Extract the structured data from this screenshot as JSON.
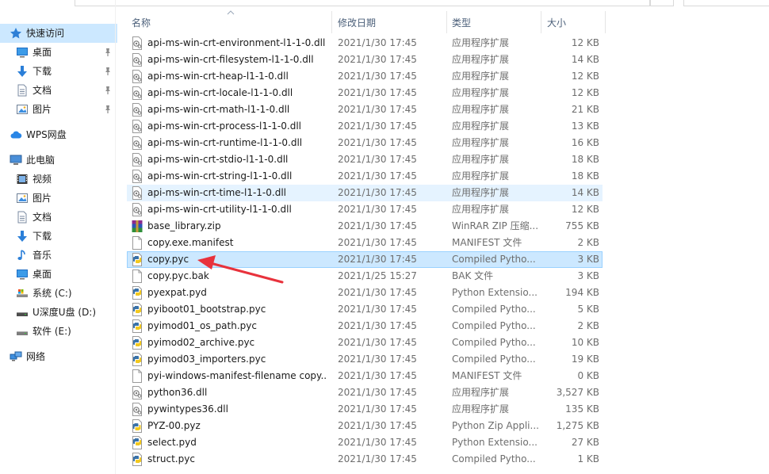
{
  "sidebar": {
    "items": [
      {
        "label": "快速访问",
        "icon": "star-icon",
        "indent": 0,
        "selected": true,
        "pinned": false
      },
      {
        "label": "桌面",
        "icon": "desktop-icon",
        "indent": 1,
        "selected": false,
        "pinned": true
      },
      {
        "label": "下载",
        "icon": "download-icon",
        "indent": 1,
        "selected": false,
        "pinned": true
      },
      {
        "label": "文档",
        "icon": "document-icon",
        "indent": 1,
        "selected": false,
        "pinned": true
      },
      {
        "label": "图片",
        "icon": "picture-icon",
        "indent": 1,
        "selected": false,
        "pinned": true
      },
      {
        "label": "WPS网盘",
        "icon": "cloud-icon",
        "indent": 0,
        "selected": false,
        "pinned": false
      },
      {
        "label": "此电脑",
        "icon": "computer-icon",
        "indent": 0,
        "selected": false,
        "pinned": false
      },
      {
        "label": "视频",
        "icon": "video-icon",
        "indent": 1,
        "selected": false,
        "pinned": false
      },
      {
        "label": "图片",
        "icon": "picture-icon",
        "indent": 1,
        "selected": false,
        "pinned": false
      },
      {
        "label": "文档",
        "icon": "document-icon",
        "indent": 1,
        "selected": false,
        "pinned": false
      },
      {
        "label": "下载",
        "icon": "download-icon",
        "indent": 1,
        "selected": false,
        "pinned": false
      },
      {
        "label": "音乐",
        "icon": "music-icon",
        "indent": 1,
        "selected": false,
        "pinned": false
      },
      {
        "label": "桌面",
        "icon": "desktop-icon",
        "indent": 1,
        "selected": false,
        "pinned": false
      },
      {
        "label": "系统 (C:)",
        "icon": "system-drive-icon",
        "indent": 1,
        "selected": false,
        "pinned": false
      },
      {
        "label": "U深度U盘 (D:)",
        "icon": "usb-drive-icon",
        "indent": 1,
        "selected": false,
        "pinned": false
      },
      {
        "label": "软件 (E:)",
        "icon": "drive-icon",
        "indent": 1,
        "selected": false,
        "pinned": false
      },
      {
        "label": "网络",
        "icon": "network-icon",
        "indent": 0,
        "selected": false,
        "pinned": false
      }
    ]
  },
  "columns": {
    "name": "名称",
    "date": "修改日期",
    "type": "类型",
    "size": "大小"
  },
  "files": [
    {
      "name": "api-ms-win-crt-environment-l1-1-0.dll",
      "date": "2021/1/30 17:45",
      "type": "应用程序扩展",
      "size": "12 KB",
      "icon": "dll-file-icon",
      "state": ""
    },
    {
      "name": "api-ms-win-crt-filesystem-l1-1-0.dll",
      "date": "2021/1/30 17:45",
      "type": "应用程序扩展",
      "size": "14 KB",
      "icon": "dll-file-icon",
      "state": ""
    },
    {
      "name": "api-ms-win-crt-heap-l1-1-0.dll",
      "date": "2021/1/30 17:45",
      "type": "应用程序扩展",
      "size": "12 KB",
      "icon": "dll-file-icon",
      "state": ""
    },
    {
      "name": "api-ms-win-crt-locale-l1-1-0.dll",
      "date": "2021/1/30 17:45",
      "type": "应用程序扩展",
      "size": "12 KB",
      "icon": "dll-file-icon",
      "state": ""
    },
    {
      "name": "api-ms-win-crt-math-l1-1-0.dll",
      "date": "2021/1/30 17:45",
      "type": "应用程序扩展",
      "size": "21 KB",
      "icon": "dll-file-icon",
      "state": ""
    },
    {
      "name": "api-ms-win-crt-process-l1-1-0.dll",
      "date": "2021/1/30 17:45",
      "type": "应用程序扩展",
      "size": "13 KB",
      "icon": "dll-file-icon",
      "state": ""
    },
    {
      "name": "api-ms-win-crt-runtime-l1-1-0.dll",
      "date": "2021/1/30 17:45",
      "type": "应用程序扩展",
      "size": "16 KB",
      "icon": "dll-file-icon",
      "state": ""
    },
    {
      "name": "api-ms-win-crt-stdio-l1-1-0.dll",
      "date": "2021/1/30 17:45",
      "type": "应用程序扩展",
      "size": "18 KB",
      "icon": "dll-file-icon",
      "state": ""
    },
    {
      "name": "api-ms-win-crt-string-l1-1-0.dll",
      "date": "2021/1/30 17:45",
      "type": "应用程序扩展",
      "size": "18 KB",
      "icon": "dll-file-icon",
      "state": ""
    },
    {
      "name": "api-ms-win-crt-time-l1-1-0.dll",
      "date": "2021/1/30 17:45",
      "type": "应用程序扩展",
      "size": "14 KB",
      "icon": "dll-file-icon",
      "state": "hover"
    },
    {
      "name": "api-ms-win-crt-utility-l1-1-0.dll",
      "date": "2021/1/30 17:45",
      "type": "应用程序扩展",
      "size": "12 KB",
      "icon": "dll-file-icon",
      "state": ""
    },
    {
      "name": "base_library.zip",
      "date": "2021/1/30 17:45",
      "type": "WinRAR ZIP 压缩...",
      "size": "755 KB",
      "icon": "winrar-archive-icon",
      "state": ""
    },
    {
      "name": "copy.exe.manifest",
      "date": "2021/1/30 17:45",
      "type": "MANIFEST 文件",
      "size": "2 KB",
      "icon": "blank-file-icon",
      "state": ""
    },
    {
      "name": "copy.pyc",
      "date": "2021/1/30 17:45",
      "type": "Compiled Pytho...",
      "size": "3 KB",
      "icon": "python-compiled-icon",
      "state": "selected"
    },
    {
      "name": "copy.pyc.bak",
      "date": "2021/1/25 15:27",
      "type": "BAK 文件",
      "size": "3 KB",
      "icon": "blank-file-icon",
      "state": ""
    },
    {
      "name": "pyexpat.pyd",
      "date": "2021/1/30 17:45",
      "type": "Python Extensio...",
      "size": "194 KB",
      "icon": "python-extension-icon",
      "state": ""
    },
    {
      "name": "pyiboot01_bootstrap.pyc",
      "date": "2021/1/30 17:45",
      "type": "Compiled Pytho...",
      "size": "5 KB",
      "icon": "python-compiled-icon",
      "state": ""
    },
    {
      "name": "pyimod01_os_path.pyc",
      "date": "2021/1/30 17:45",
      "type": "Compiled Pytho...",
      "size": "2 KB",
      "icon": "python-compiled-icon",
      "state": ""
    },
    {
      "name": "pyimod02_archive.pyc",
      "date": "2021/1/30 17:45",
      "type": "Compiled Pytho...",
      "size": "10 KB",
      "icon": "python-compiled-icon",
      "state": ""
    },
    {
      "name": "pyimod03_importers.pyc",
      "date": "2021/1/30 17:45",
      "type": "Compiled Pytho...",
      "size": "19 KB",
      "icon": "python-compiled-icon",
      "state": ""
    },
    {
      "name": "pyi-windows-manifest-filename copy....",
      "date": "2021/1/30 17:45",
      "type": "MANIFEST 文件",
      "size": "0 KB",
      "icon": "blank-file-icon",
      "state": ""
    },
    {
      "name": "python36.dll",
      "date": "2021/1/30 17:45",
      "type": "应用程序扩展",
      "size": "3,527 KB",
      "icon": "dll-file-icon",
      "state": ""
    },
    {
      "name": "pywintypes36.dll",
      "date": "2021/1/30 17:45",
      "type": "应用程序扩展",
      "size": "135 KB",
      "icon": "dll-file-icon",
      "state": ""
    },
    {
      "name": "PYZ-00.pyz",
      "date": "2021/1/30 17:45",
      "type": "Python Zip Appli...",
      "size": "1,275 KB",
      "icon": "python-zip-icon",
      "state": ""
    },
    {
      "name": "select.pyd",
      "date": "2021/1/30 17:45",
      "type": "Python Extensio...",
      "size": "27 KB",
      "icon": "python-extension-icon",
      "state": ""
    },
    {
      "name": "struct.pyc",
      "date": "2021/1/30 17:45",
      "type": "Compiled Pytho...",
      "size": "1 KB",
      "icon": "python-compiled-icon",
      "state": ""
    }
  ],
  "colors": {
    "selection": "#cce8ff",
    "selection_border": "#99d1ff",
    "hover": "#e5f3ff",
    "header_text": "#4c607a",
    "secondary_text": "#6d6d6d",
    "annotation_arrow": "#e8323c"
  }
}
